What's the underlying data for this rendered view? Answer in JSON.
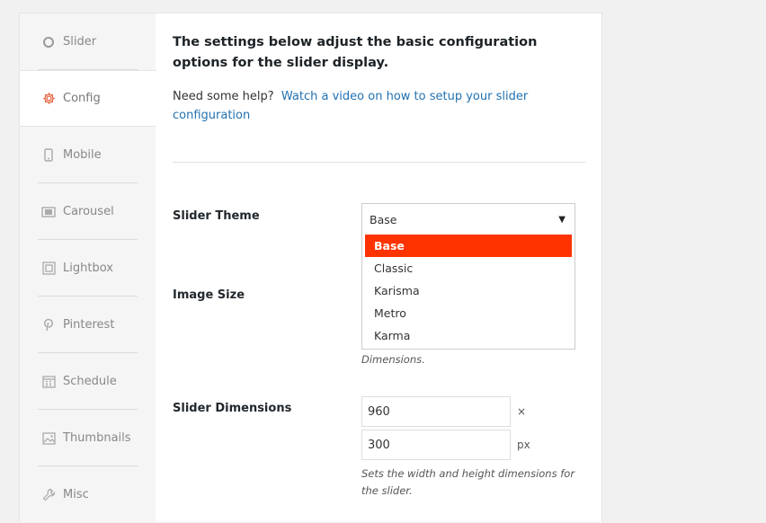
{
  "sidebar": {
    "items": [
      {
        "label": "Slider",
        "icon": "slider-icon"
      },
      {
        "label": "Config",
        "icon": "gear-icon",
        "active": true
      },
      {
        "label": "Mobile",
        "icon": "mobile-icon"
      },
      {
        "label": "Carousel",
        "icon": "carousel-icon"
      },
      {
        "label": "Lightbox",
        "icon": "lightbox-icon"
      },
      {
        "label": "Pinterest",
        "icon": "pinterest-icon"
      },
      {
        "label": "Schedule",
        "icon": "calendar-icon"
      },
      {
        "label": "Thumbnails",
        "icon": "image-icon"
      },
      {
        "label": "Misc",
        "icon": "wrench-icon"
      }
    ]
  },
  "main": {
    "intro": "The settings below adjust the basic configuration options for the slider display.",
    "help_prefix": "Need some help?",
    "help_link": "Watch a video on how to setup your slider configuration",
    "slider_theme": {
      "label": "Slider Theme",
      "selected": "Base",
      "options": [
        "Base",
        "Classic",
        "Karisma",
        "Metro",
        "Karma"
      ]
    },
    "image_size": {
      "label": "Image Size",
      "desc": "Dimensions."
    },
    "slider_dimensions": {
      "label": "Slider Dimensions",
      "width": "960",
      "height": "300",
      "times": "×",
      "unit": "px",
      "desc": "Sets the width and height dimensions for the slider."
    }
  },
  "colors": {
    "accent": "#ff3300",
    "link": "#2271b1"
  }
}
